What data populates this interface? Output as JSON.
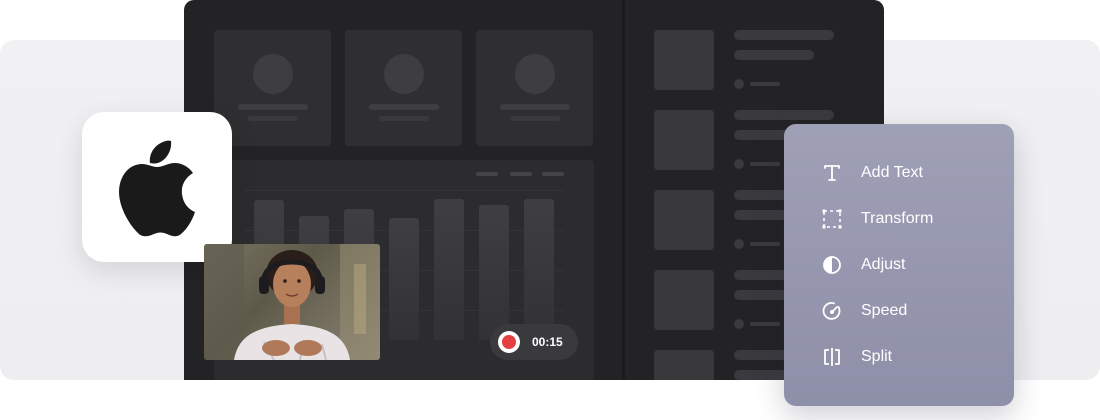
{
  "recording": {
    "timer": "00:15"
  },
  "tools": [
    {
      "label": "Add Text",
      "icon": "text-icon"
    },
    {
      "label": "Transform",
      "icon": "transform-icon"
    },
    {
      "label": "Adjust",
      "icon": "adjust-icon"
    },
    {
      "label": "Speed",
      "icon": "speed-icon"
    },
    {
      "label": "Split",
      "icon": "split-icon"
    }
  ],
  "colors": {
    "record_red": "#e43f43",
    "panel": "#9a9bb2",
    "editor_bg": "#232325"
  }
}
